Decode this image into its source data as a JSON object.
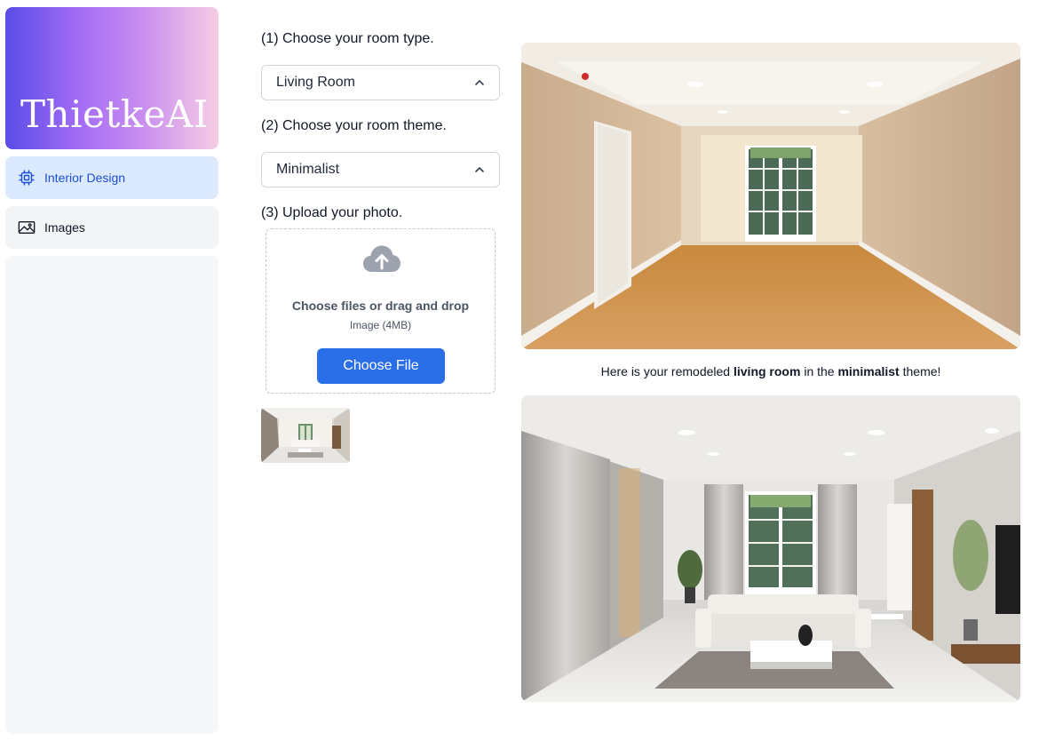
{
  "app": {
    "logo_text": "ThietkeAI"
  },
  "sidebar": {
    "items": [
      {
        "label": "Interior Design",
        "icon": "cpu-chip-icon",
        "active": true
      },
      {
        "label": "Images",
        "icon": "image-icon",
        "active": false
      }
    ]
  },
  "form": {
    "step1": {
      "label": "(1) Choose your room type.",
      "selected": "Living Room"
    },
    "step2": {
      "label": "(2) Choose your room theme.",
      "selected": "Minimalist"
    },
    "step3": {
      "label": "(3) Upload your photo.",
      "dropzone_title": "Choose files or drag and drop",
      "dropzone_hint": "Image (4MB)",
      "button_label": "Choose File",
      "icon": "cloud-upload-icon"
    }
  },
  "result": {
    "caption_prefix": "Here is your remodeled",
    "room": "living room",
    "caption_middle": "in the",
    "theme": "minimalist",
    "caption_suffix": "theme!"
  },
  "colors": {
    "accent": "#2b6fe8",
    "active_nav_bg": "#dbeafe",
    "active_nav_text": "#1d4ed8",
    "logo_gradient_start": "#5b4ce8",
    "logo_gradient_end": "#f6cde4"
  }
}
